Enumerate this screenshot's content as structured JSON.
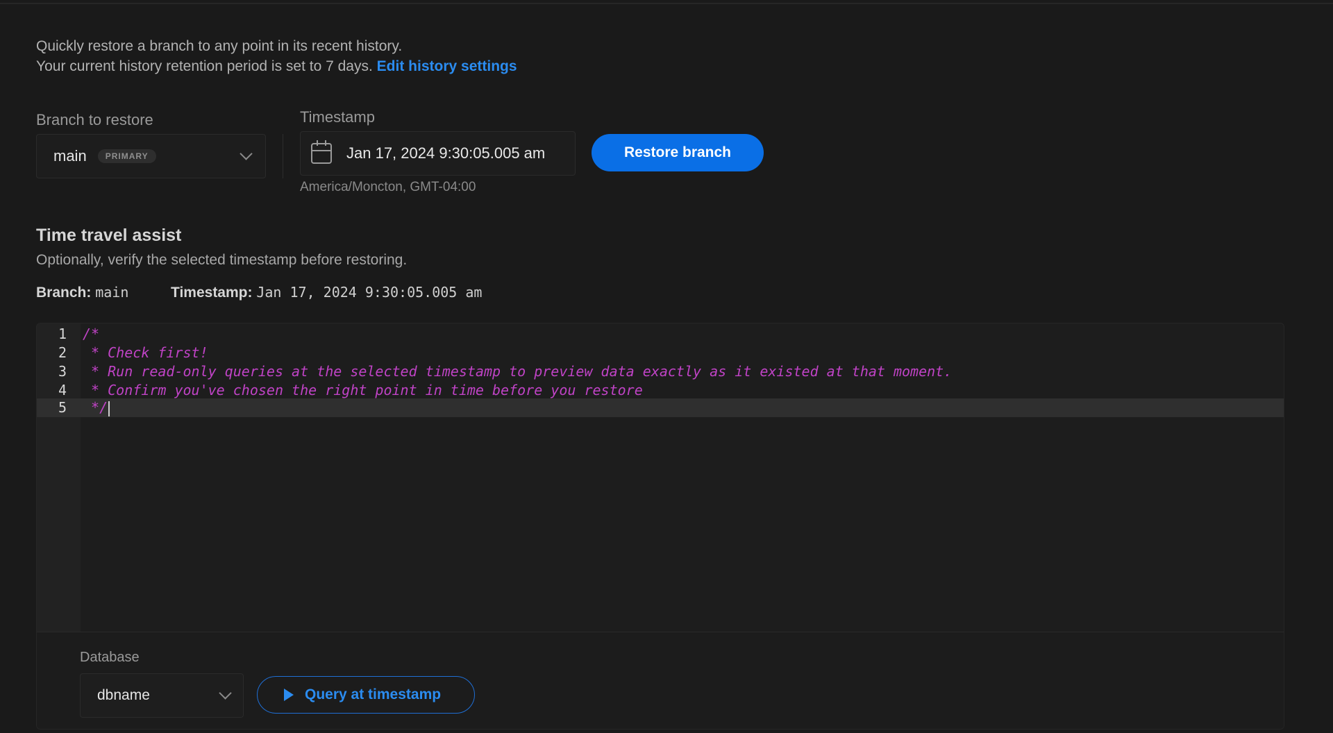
{
  "intro": {
    "line1": "Quickly restore a branch to any point in its recent history.",
    "line2": "Your current history retention period is set to 7 days.",
    "edit_link": "Edit history settings"
  },
  "branch_field": {
    "label": "Branch to restore",
    "value": "main",
    "badge": "PRIMARY"
  },
  "timestamp_field": {
    "label": "Timestamp",
    "value": "Jan 17, 2024 9:30:05.005 am",
    "timezone": "America/Moncton, GMT-04:00"
  },
  "restore_button": "Restore branch",
  "time_travel": {
    "title": "Time travel assist",
    "subtitle": "Optionally, verify the selected timestamp before restoring.",
    "branch_label": "Branch:",
    "branch_value": "main",
    "timestamp_label": "Timestamp:",
    "timestamp_value": "Jan 17, 2024 9:30:05.005 am"
  },
  "editor": {
    "lines": [
      {
        "no": "1",
        "text": "/*"
      },
      {
        "no": "2",
        "text": " * Check first!"
      },
      {
        "no": "3",
        "text": " * Run read-only queries at the selected timestamp to preview data exactly as it existed at that moment."
      },
      {
        "no": "4",
        "text": " * Confirm you've chosen the right point in time before you restore"
      },
      {
        "no": "5",
        "text": " */"
      }
    ],
    "active_line": 5
  },
  "database": {
    "label": "Database",
    "value": "dbname"
  },
  "query_button": "Query at timestamp",
  "colors": {
    "accent": "#0a6fe6",
    "link": "#2b8cf0",
    "comment": "#c043c6",
    "background": "#1a1a1a"
  }
}
